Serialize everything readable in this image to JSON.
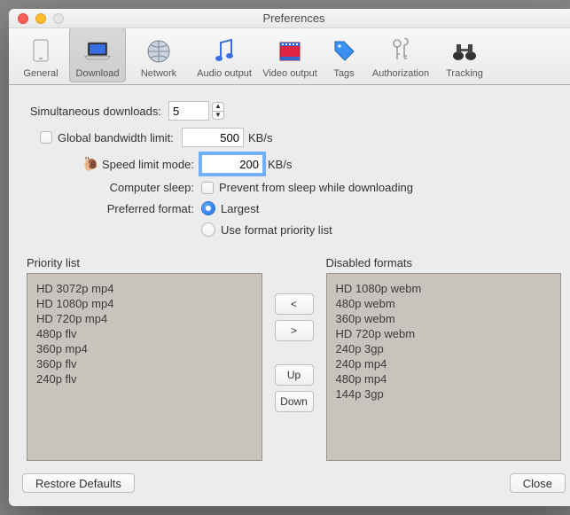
{
  "window": {
    "title": "Preferences"
  },
  "tabs": {
    "general": "General",
    "download": "Download",
    "network": "Network",
    "audio": "Audio output",
    "video": "Video output",
    "tags": "Tags",
    "authorization": "Authorization",
    "tracking": "Tracking"
  },
  "form": {
    "simultaneousLabel": "Simultaneous downloads:",
    "simultaneousValue": "5",
    "globalBwLabel": "Global bandwidth limit:",
    "globalBwValue": "500",
    "kbps": "KB/s",
    "speedLimitLabel": "Speed limit mode:",
    "speedLimitValue": "200",
    "computerSleepLabel": "Computer sleep:",
    "preventSleep": "Prevent from sleep while downloading",
    "preferredFormatLabel": "Preferred format:",
    "largest": "Largest",
    "usePriority": "Use format priority list"
  },
  "priority": {
    "label": "Priority list",
    "items": [
      "HD 3072p mp4",
      "HD 1080p mp4",
      "HD 720p mp4",
      "480p flv",
      "360p mp4",
      "360p flv",
      "240p flv"
    ]
  },
  "disabled": {
    "label": "Disabled formats",
    "items": [
      "HD 1080p webm",
      "480p webm",
      "360p webm",
      "HD 720p webm",
      "240p 3gp",
      "240p mp4",
      "480p mp4",
      "144p 3gp"
    ]
  },
  "moveBtns": {
    "left": "<",
    "right": ">",
    "up": "Up",
    "down": "Down"
  },
  "bottom": {
    "restore": "Restore Defaults",
    "close": "Close"
  }
}
